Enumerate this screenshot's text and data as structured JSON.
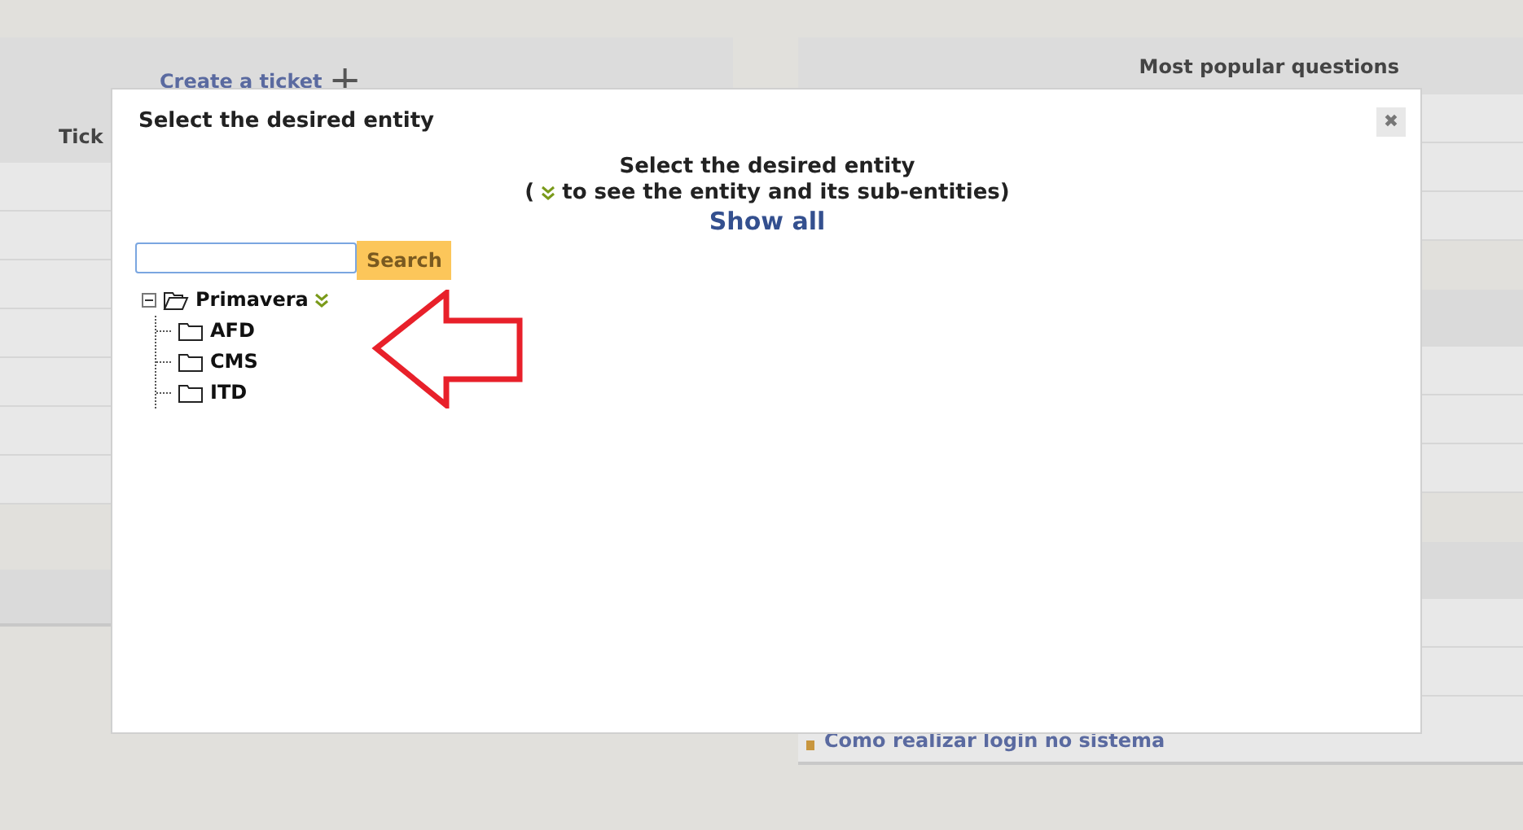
{
  "left_panel": {
    "create_link": "Create a ticket",
    "create_icon": "+",
    "column_label": "Tick"
  },
  "right_panel": {
    "title": "Most popular questions",
    "questions": [
      "Como realizar login no sistema"
    ]
  },
  "dialog": {
    "title": "Select the desired entity",
    "close": "✖",
    "instructions": {
      "line_1": "Select the desired entity",
      "line_2_prefix": "(",
      "line_2_text": "to see the entity and its sub-entities)",
      "show_all": "Show all"
    },
    "search": {
      "button": "Search"
    },
    "tree": [
      {
        "label": "Primavera",
        "expanded": true,
        "children": [
          {
            "label": "AFD"
          },
          {
            "label": "CMS"
          },
          {
            "label": "ITD"
          }
        ]
      }
    ]
  }
}
